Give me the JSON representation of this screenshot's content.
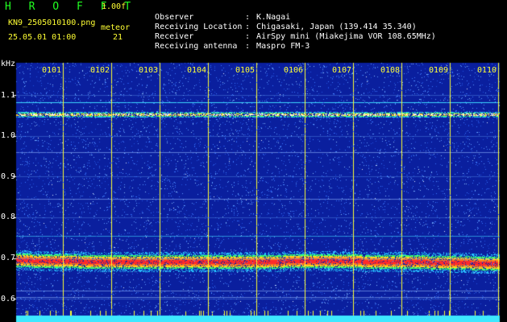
{
  "header": {
    "title": "H R O F F T",
    "version": "1.00f",
    "file_name": "KN9_2505010100.png",
    "date_time": "25.05.01 01:00",
    "meteor_label": "meteor",
    "meteor_count": "21"
  },
  "info": [
    {
      "label": "Observer",
      "value": "K.Nagai"
    },
    {
      "label": "Receiving Location",
      "value": "Chigasaki, Japan (139.414 35.340)"
    },
    {
      "label": "Receiver",
      "value": "AirSpy mini (Miakejima VOR 108.65MHz)"
    },
    {
      "label": "Receiving antenna",
      "value": "Maspro FM-3"
    }
  ],
  "chart_data": {
    "type": "heatmap",
    "ylabel": "kHz",
    "y_ticks": [
      "1.1",
      "1.0",
      "0.9",
      "0.8",
      "0.7",
      "0.6"
    ],
    "ylim": [
      0.56,
      1.18
    ],
    "x_ticks": [
      "0101",
      "0102",
      "0103",
      "0104",
      "0105",
      "0106",
      "0107",
      "0108",
      "0109",
      "0110"
    ],
    "bands": [
      {
        "freq": 1.083,
        "intensity": "weak"
      },
      {
        "freq": 1.052,
        "intensity": "medium"
      },
      {
        "freq": 0.695,
        "intensity": "strong"
      }
    ],
    "colors": {
      "background": "#0a1f9e",
      "noise": "#2f6bff",
      "band_strong": "#ff2a2a",
      "band_medium": "#ffd21e",
      "bottom_strip": "#3de8ff"
    }
  }
}
